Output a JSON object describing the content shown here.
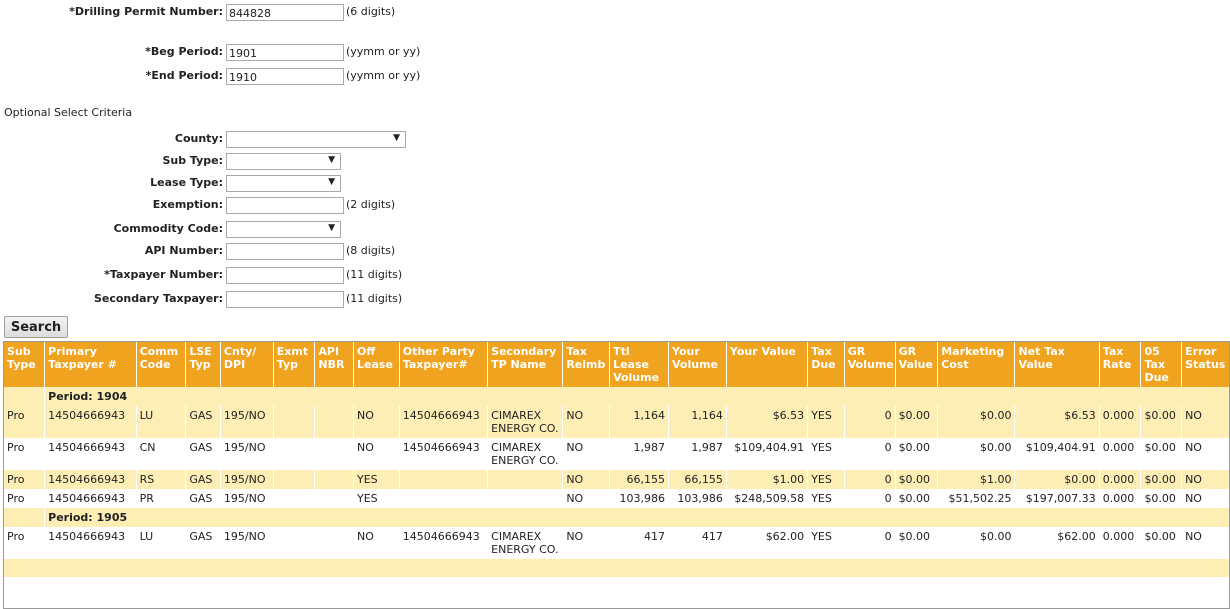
{
  "form": {
    "permit": {
      "label": "*Drilling Permit Number:",
      "value": "844828",
      "hint": "(6 digits)"
    },
    "beg": {
      "label": "*Beg Period:",
      "value": "1901",
      "hint": "(yymm or yy)"
    },
    "end": {
      "label": "*End Period:",
      "value": "1910",
      "hint": "(yymm or yy)"
    },
    "optional_title": "Optional Select Criteria",
    "county": {
      "label": "County:",
      "value": ""
    },
    "subtype": {
      "label": "Sub Type:",
      "value": ""
    },
    "leasetype": {
      "label": "Lease Type:",
      "value": ""
    },
    "exemption": {
      "label": "Exemption:",
      "value": "",
      "hint": "(2 digits)"
    },
    "commodity": {
      "label": "Commodity Code:",
      "value": ""
    },
    "api": {
      "label": "API Number:",
      "value": "",
      "hint": "(8 digits)"
    },
    "taxpayer": {
      "label": "*Taxpayer Number:",
      "value": "",
      "hint": "(11 digits)"
    },
    "sectaxpayer": {
      "label": "Secondary Taxpayer:",
      "value": "",
      "hint": "(11 digits)"
    },
    "search_label": "Search"
  },
  "table": {
    "headers": [
      "Sub Type",
      "Primary Taxpayer #",
      "Comm Code",
      "LSE Typ",
      "Cnty/ DPI",
      "Exmt Typ",
      "API NBR",
      "Off Lease",
      "Other Party Taxpayer#",
      "Secondary TP Name",
      "Tax Reimb",
      "Ttl Lease Volume",
      "Your Volume",
      "Your Value",
      "Tax Due",
      "GR Volume",
      "GR Value",
      "Marketing Cost",
      "Net Tax Value",
      "Tax Rate",
      "05 Tax Due",
      "Error Status"
    ],
    "period1": "Period: 1904",
    "period2": "Period: 1905",
    "rows": [
      [
        "Pro",
        "14504666943",
        "LU",
        "GAS",
        "195/NO",
        "",
        "",
        "NO",
        "14504666943",
        "CIMAREX ENERGY CO.",
        "NO",
        "1,164",
        "1,164",
        "$6.53",
        "YES",
        "0",
        "$0.00",
        "$0.00",
        "$6.53",
        "0.000",
        "$0.00",
        "NO"
      ],
      [
        "Pro",
        "14504666943",
        "CN",
        "GAS",
        "195/NO",
        "",
        "",
        "NO",
        "14504666943",
        "CIMAREX ENERGY CO.",
        "NO",
        "1,987",
        "1,987",
        "$109,404.91",
        "YES",
        "0",
        "$0.00",
        "$0.00",
        "$109,404.91",
        "0.000",
        "$0.00",
        "NO"
      ],
      [
        "Pro",
        "14504666943",
        "RS",
        "GAS",
        "195/NO",
        "",
        "",
        "YES",
        "",
        "",
        "NO",
        "66,155",
        "66,155",
        "$1.00",
        "YES",
        "0",
        "$0.00",
        "$1.00",
        "$0.00",
        "0.000",
        "$0.00",
        "NO"
      ],
      [
        "Pro",
        "14504666943",
        "PR",
        "GAS",
        "195/NO",
        "",
        "",
        "YES",
        "",
        "",
        "NO",
        "103,986",
        "103,986",
        "$248,509.58",
        "YES",
        "0",
        "$0.00",
        "$51,502.25",
        "$197,007.33",
        "0.000",
        "$0.00",
        "NO"
      ],
      [
        "Pro",
        "14504666943",
        "LU",
        "GAS",
        "195/NO",
        "",
        "",
        "NO",
        "14504666943",
        "CIMAREX ENERGY CO.",
        "NO",
        "417",
        "417",
        "$62.00",
        "YES",
        "0",
        "$0.00",
        "$0.00",
        "$62.00",
        "0.000",
        "$0.00",
        "NO"
      ]
    ]
  }
}
